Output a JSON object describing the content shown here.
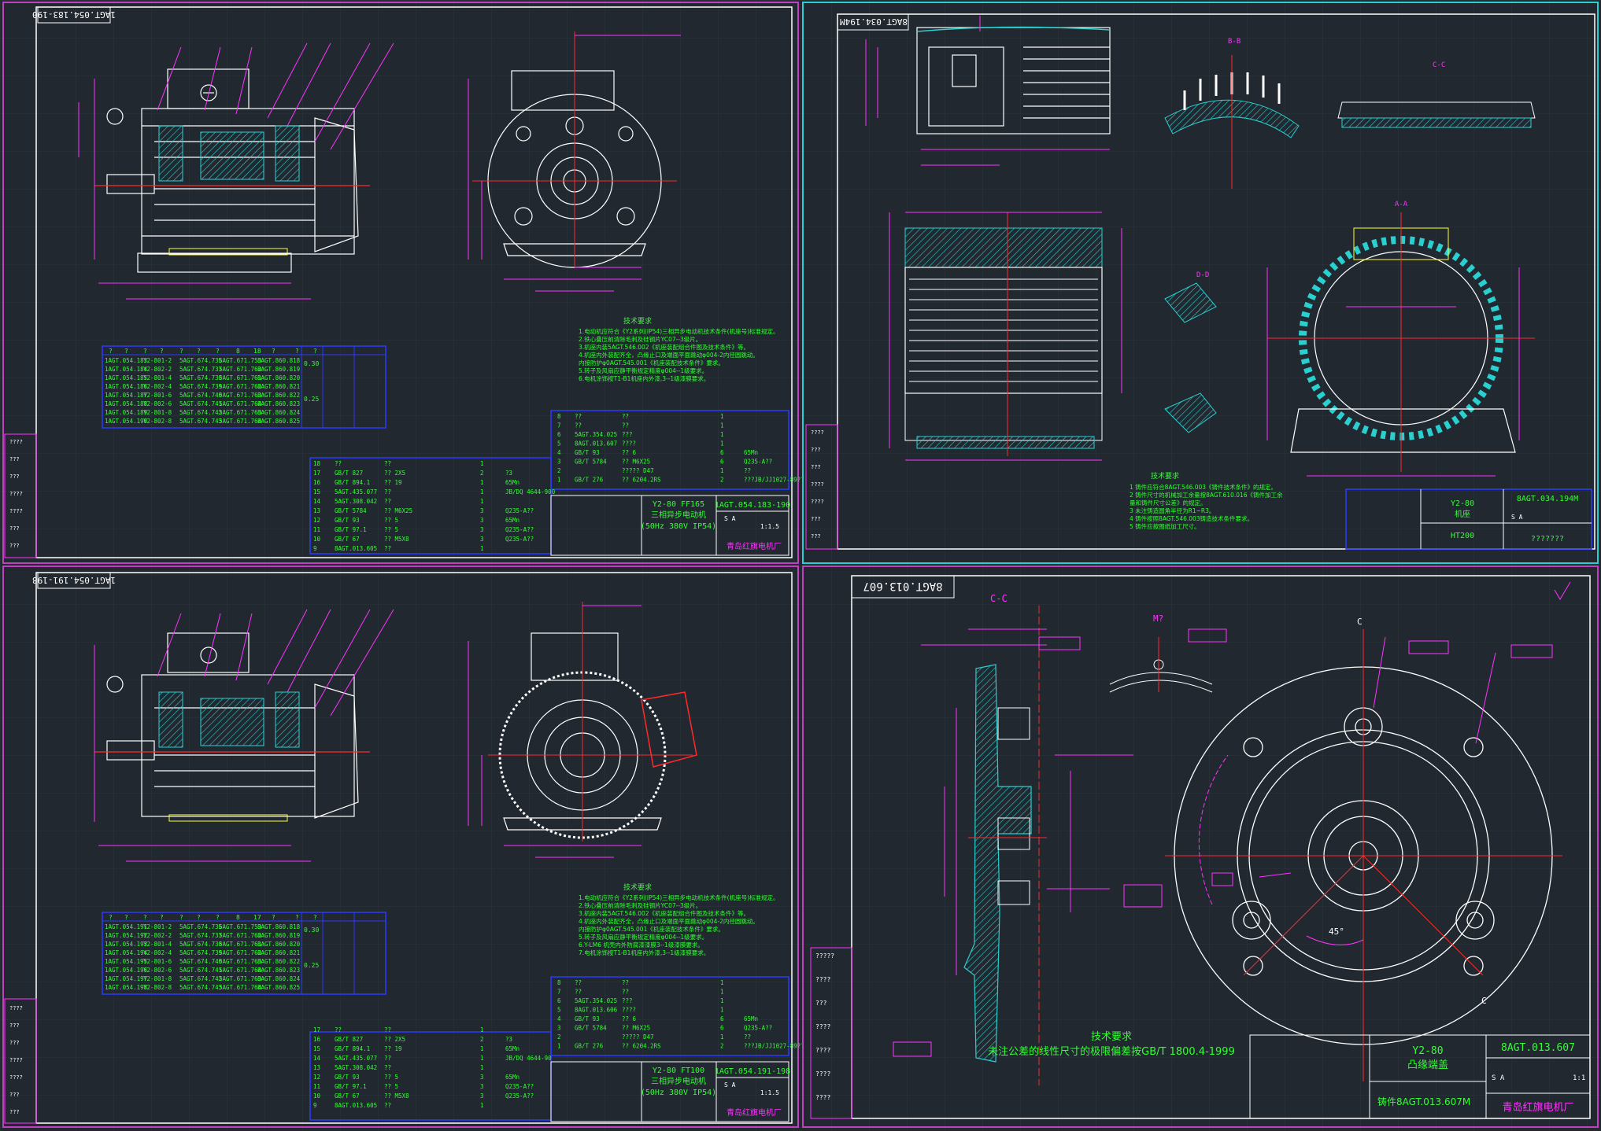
{
  "sheets": [
    {
      "id": "q1",
      "frame_color": "#ffffff",
      "stamp": "1AGT.054.183-190",
      "parts_table": {
        "header": [
          "?",
          "?",
          "?",
          "?",
          "?",
          "?",
          "?",
          "8",
          "18",
          "?",
          "?",
          "?"
        ],
        "rows": [
          [
            "1AGT.054.183",
            "Y2-801-2",
            "5AGT.674.735",
            "6AGT.671.753",
            "8AGT.860.818"
          ],
          [
            "1AGT.054.184",
            "Y2-802-2",
            "5AGT.674.737",
            "5AGT.671.762",
            "8AGT.860.819"
          ],
          [
            "1AGT.054.185",
            "Y2-801-4",
            "5AGT.674.738",
            "5AGT.671.761",
            "8AGT.860.820"
          ],
          [
            "1AGT.054.186",
            "Y2-802-4",
            "5AGT.674.739",
            "5AGT.671.762",
            "8AGT.860.821"
          ],
          [
            "1AGT.054.187",
            "Y2-801-6",
            "5AGT.674.740",
            "5AGT.671.763",
            "8AGT.860.822"
          ],
          [
            "1AGT.054.188",
            "Y2-802-6",
            "5AGT.674.741",
            "5AGT.671.764",
            "8AGT.860.823"
          ],
          [
            "1AGT.054.189",
            "Y2-801-8",
            "5AGT.674.742",
            "5AGT.671.763",
            "8AGT.860.824"
          ],
          [
            "1AGT.054.190",
            "Y2-802-8",
            "5AGT.674.743",
            "5AGT.671.764",
            "8AGT.860.825"
          ]
        ],
        "values": [
          "0.30",
          "0.25"
        ]
      },
      "tech_title": "技术要求",
      "tech_lines": [
        "1.电动机应符合《Y2系列(IP54)三相异步电动机技术条件(机座号)标准规定。",
        "2.铁心叠压前清除毛刺及硅钢片YC07--3级片。",
        "3.机座内装5AGT.546.002《机座装配组合件图及技术条件》等。",
        "4.机座内外装配齐全，凸缘止口及端面平面跳动φ004-2内径圆跳动。",
        "   内接防护φ0AGT.545.001《机座装配技术条件》要求。",
        "5.转子及风扇应静平衡规定精度φ004--1级要求。",
        "6.电机涂饰按T1-B1机座内外漆,3--1级漆膜要求。"
      ],
      "bom_upper": [
        [
          "8",
          "??",
          "??",
          "1"
        ],
        [
          "7",
          "??",
          "??",
          "1"
        ],
        [
          "6",
          "5AGT.354.025",
          "???",
          "1"
        ],
        [
          "5",
          "8AGT.013.607",
          "????",
          "1"
        ],
        [
          "4",
          "GB/T 93",
          "?? 6",
          "6",
          "65Mn"
        ],
        [
          "3",
          "GB/T 5784",
          "?? M6X25",
          "6",
          "Q235-A??"
        ],
        [
          "2",
          "",
          "????? D47",
          "1",
          "??"
        ],
        [
          "1",
          "GB/T 276",
          "?? 6204.2RS",
          "2",
          "???JB/JJ1027-89??"
        ]
      ],
      "bom_lower": [
        [
          "18",
          "??",
          "??",
          "1"
        ],
        [
          "17",
          "GB/T 827",
          "?? 2X5",
          "2",
          "?3"
        ],
        [
          "16",
          "GB/T 894.1",
          "?? 19",
          "1",
          "65Mn"
        ],
        [
          "15",
          "5AGT.435.077",
          "??",
          "1",
          "JB/DQ 4644-900"
        ],
        [
          "14",
          "5AGT.308.042",
          "??",
          "1"
        ],
        [
          "13",
          "GB/T 5784",
          "?? M6X25",
          "3",
          "Q235-A??"
        ],
        [
          "12",
          "GB/T 93",
          "?? 5",
          "3",
          "65Mn"
        ],
        [
          "11",
          "GB/T 97.1",
          "?? 5",
          "3",
          "Q235-A??"
        ],
        [
          "10",
          "GB/T 67",
          "?? M5X8",
          "3",
          "Q235-A??"
        ],
        [
          "9",
          "8AGT.013.605",
          "??",
          "1"
        ]
      ],
      "title_block": {
        "name": "Y2-80 FF165",
        "sub": "三相异步电动机",
        "spec": "(50Hz 380V IP54)",
        "drawing_no": "1AGT.054.183-190",
        "scale": "1:1.5",
        "company": "青岛红旗电机厂",
        "sheet_mark": "S A"
      },
      "side_labels": [
        "????",
        "???",
        "???",
        "????",
        "????",
        "???",
        "???"
      ]
    },
    {
      "id": "q3",
      "frame_color": "#ffffff",
      "stamp": "1AGT.054.191-198",
      "parts_table": {
        "header": [
          "?",
          "?",
          "?",
          "?",
          "?",
          "?",
          "?",
          "8",
          "17",
          "?",
          "?",
          "?"
        ],
        "rows": [
          [
            "1AGT.054.191",
            "Y2-801-2",
            "5AGT.674.735",
            "6AGT.671.753",
            "8AGT.860.818"
          ],
          [
            "1AGT.054.192",
            "Y2-802-2",
            "5AGT.674.737",
            "5AGT.671.762",
            "8AGT.860.819"
          ],
          [
            "1AGT.054.193",
            "Y2-801-4",
            "5AGT.674.738",
            "5AGT.671.761",
            "8AGT.860.820"
          ],
          [
            "1AGT.054.194",
            "Y2-802-4",
            "5AGT.674.739",
            "5AGT.671.762",
            "8AGT.860.821"
          ],
          [
            "1AGT.054.195",
            "Y2-801-6",
            "5AGT.674.740",
            "5AGT.671.763",
            "8AGT.860.822"
          ],
          [
            "1AGT.054.196",
            "Y2-802-6",
            "5AGT.674.741",
            "5AGT.671.764",
            "8AGT.860.823"
          ],
          [
            "1AGT.054.197",
            "Y2-801-8",
            "5AGT.674.742",
            "5AGT.671.763",
            "8AGT.860.824"
          ],
          [
            "1AGT.054.198",
            "Y2-802-8",
            "5AGT.674.743",
            "5AGT.671.764",
            "8AGT.860.825"
          ]
        ],
        "values": [
          "0.30",
          "0.25"
        ]
      },
      "tech_title": "技术要求",
      "tech_lines": [
        "1.电动机应符合《Y2系列(IP54)三相异步电动机技术条件(机座号)标准规定。",
        "2.铁心叠压前清除毛刺及硅钢片YC07--3级片。",
        "3.机座内装5AGT.546.002《机座装配组合件图及技术条件》等。",
        "4.机座内外装配齐全，凸缘止口及端面平面跳动φ004-2内径圆跳动。",
        "   内接防护φ0AGT.545.001《机座装配技术条件》要求。",
        "5.转子及风扇应静平衡规定精度φ004--1级要求。",
        "6.Y-LM6 机壳内外防腐漆漆膜3--1级漆膜要求。",
        "7.电机涂饰按T1-B1机座内外漆,3--1级漆膜要求。"
      ],
      "bom_upper": [
        [
          "8",
          "??",
          "??",
          "1"
        ],
        [
          "7",
          "??",
          "??",
          "1"
        ],
        [
          "6",
          "5AGT.354.025",
          "???",
          "1"
        ],
        [
          "5",
          "8AGT.013.606",
          "????",
          "1"
        ],
        [
          "4",
          "GB/T 93",
          "?? 6",
          "6",
          "65Mn"
        ],
        [
          "3",
          "GB/T 5784",
          "?? M6X25",
          "6",
          "Q235-A??"
        ],
        [
          "2",
          "",
          "????? D47",
          "1",
          "??"
        ],
        [
          "1",
          "GB/T 276",
          "?? 6204.2RS",
          "2",
          "???JB/JJ1027-89??"
        ]
      ],
      "bom_lower": [
        [
          "17",
          "??",
          "??",
          "1"
        ],
        [
          "16",
          "GB/T 827",
          "?? 2X5",
          "2",
          "?3"
        ],
        [
          "15",
          "GB/T 894.1",
          "?? 19",
          "1",
          "65Mn"
        ],
        [
          "14",
          "5AGT.435.077",
          "??",
          "1",
          "JB/DQ 4644-90"
        ],
        [
          "13",
          "5AGT.308.042",
          "??",
          "1"
        ],
        [
          "12",
          "GB/T 93",
          "?? 5",
          "3",
          "65Mn"
        ],
        [
          "11",
          "GB/T 97.1",
          "?? 5",
          "3",
          "Q235-A??"
        ],
        [
          "10",
          "GB/T 67",
          "?? M5X8",
          "3",
          "Q235-A??"
        ],
        [
          "9",
          "8AGT.013.605",
          "??",
          "1"
        ]
      ],
      "title_block": {
        "name": "Y2-80 FT100",
        "sub": "三相异步电动机",
        "spec": "(50Hz 380V IP54)",
        "drawing_no": "1AGT.054.191-198",
        "scale": "1:1.5",
        "company": "青岛红旗电机厂",
        "sheet_mark": "S A"
      },
      "side_labels": [
        "????",
        "???",
        "???",
        "????",
        "????",
        "???",
        "???"
      ]
    }
  ],
  "q2": {
    "frame_color": "#2ad0d0",
    "stamp": "8AGT.034.194M",
    "section_labels": [
      "B-B",
      "C-C",
      "D-D",
      "A-A"
    ],
    "tech_title": "技术要求",
    "tech_lines": [
      "1 铸件应符合8AGT.546.003《铸件技术条件》的规定。",
      "2 铸件尺寸的机械加工余量按8AGT.610.016《铸件加工余",
      "  量和铸件尺寸公差》的规定。",
      "3 未注铸造圆角半径为R1~R3。",
      "4 铸件按照8AGT.546.003铸造技术条件要求。",
      "5 铸件应按图纸加工尺寸。"
    ],
    "title_block": {
      "name": "Y2-80",
      "sub": "机座",
      "material": "HT200",
      "drawing_no": "8AGT.034.194M",
      "sheet_mark": "S A",
      "unknown": "???????"
    },
    "side_labels": [
      "????",
      "???",
      "???",
      "????",
      "????",
      "???",
      "???"
    ]
  },
  "q4": {
    "frame_color": "#ffffff",
    "stamp": "8AGT.013.607",
    "labels": {
      "cc": "C-C",
      "m": "M?",
      "c": "C",
      "deg": "45°"
    },
    "note_title": "技术要求",
    "note_line": "未注公差的线性尺寸的极限偏差按GB/T 1800.4-1999",
    "title_block": {
      "name": "Y2-80",
      "sub": "凸缘端盖",
      "drawing_no": "8AGT.013.607",
      "cast_ref": "铸件8AGT.013.607M",
      "company": "青岛红旗电机厂",
      "scale": "1:1",
      "sheet_mark": "S A"
    },
    "side_labels": [
      "?????",
      "????",
      "???",
      "????",
      "????",
      "????",
      "????"
    ]
  },
  "colors": {
    "background": "#212830",
    "grid": "#2c343d",
    "border": "#c040c0",
    "green": "#33ff33",
    "magenta": "#ff33ff",
    "white": "#ffffff",
    "red": "#ff2a2a",
    "cyan": "#2ad0d0",
    "yellow": "#ffff33",
    "blue": "#2a3aff"
  }
}
